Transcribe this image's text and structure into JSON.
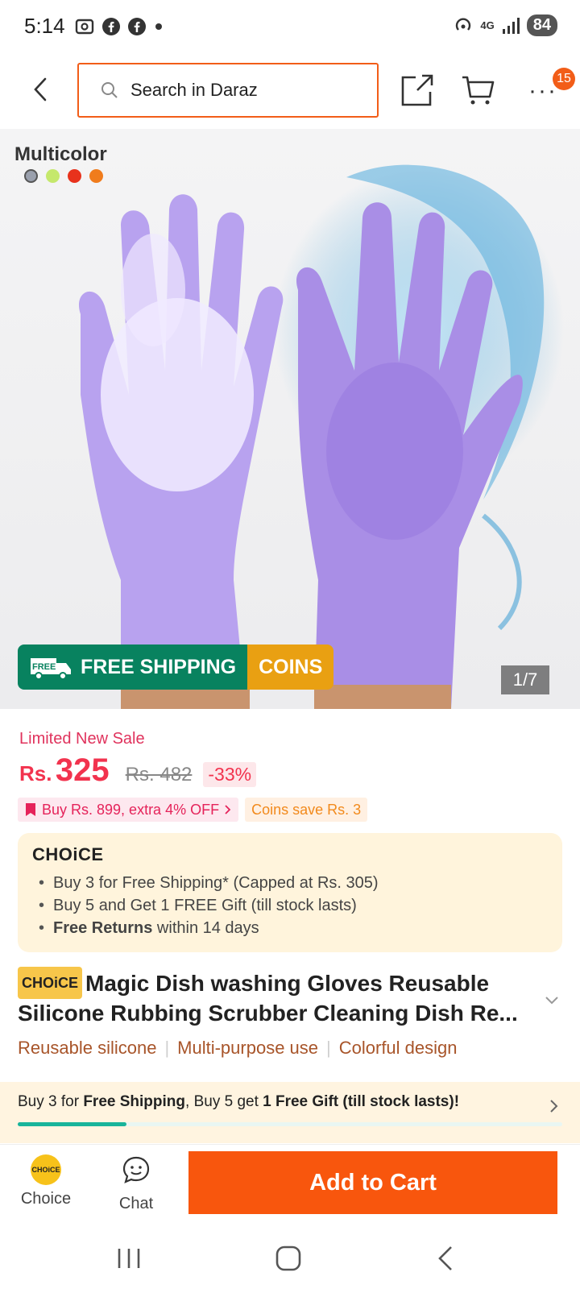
{
  "status_bar": {
    "time": "5:14",
    "network": "4G",
    "battery": "84"
  },
  "nav": {
    "search_placeholder": "Search in Daraz",
    "cart_badge": "15",
    "more_label": "···"
  },
  "hero": {
    "variant_label": "Multicolor",
    "swatch_colors": [
      "#9aa0ad",
      "#c5e86c",
      "#e8321c",
      "#f07c1c"
    ],
    "image_counter": "1/7",
    "free_tag": "FREE",
    "free_shipping_label": "FREE SHIPPING",
    "coins_label": "COINS",
    "product_color": "#a98ee6"
  },
  "pricing": {
    "sale_label": "Limited New Sale",
    "currency": "Rs.",
    "price": "325",
    "old_price": "Rs. 482",
    "discount": "-33%",
    "promo_text": "Buy Rs. 899, extra 4% OFF",
    "coins_text": "Coins save Rs. 3"
  },
  "choice_box": {
    "logo": "CHOiCE",
    "bullets": [
      {
        "bold": "",
        "text": "Buy 3 for  Free Shipping* (Capped at Rs. 305)"
      },
      {
        "bold": "",
        "text": "Buy 5 and Get 1 FREE Gift (till stock lasts)"
      },
      {
        "bold": "Free Returns",
        "text": " within 14 days"
      }
    ]
  },
  "product": {
    "choice_tag": "CHOiCE",
    "title": "Magic Dish washing Gloves Reusable Silicone Rubbing Scrubber Cleaning Dish Re...",
    "features": [
      "Reusable silicone",
      "Multi-purpose use",
      "Colorful design"
    ]
  },
  "banner": {
    "part1": "Buy 3 for ",
    "bold1": "Free Shipping",
    "part2": ", Buy 5 get ",
    "bold2": "1 Free Gift (till stock lasts)!",
    "progress_fraction": 0.2
  },
  "bottom_bar": {
    "choice_label": "Choice",
    "choice_logo": "CHOiCE",
    "chat_label": "Chat",
    "add_to_cart": "Add to Cart"
  },
  "colors": {
    "accent": "#f8560d",
    "price": "#f2334e",
    "green": "#08825f",
    "coins": "#e9a012"
  }
}
